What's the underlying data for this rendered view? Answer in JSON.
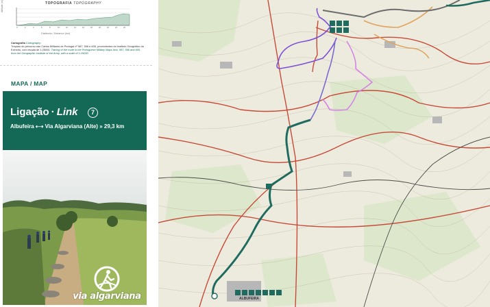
{
  "topography": {
    "title_pt": "TOPOGRAFIA",
    "title_en": "TOPOGRAPHY",
    "x_label": "Distância / Distance (km)",
    "y_label": "Altitude (m)"
  },
  "cartography": {
    "label_pt": "Cartografia",
    "label_en": "Cartography",
    "text_pt": "Traçado do percurso nas Cartas Militares de Portugal nº 587, 596 e 605, provenientes do Instituto Geográfico do Exército, com escala de 1:25000.",
    "text_en": "Tracing of the route in the Portuguese Military Maps Nos. 587, 596 and 605, from the Geographic Institute of the Army, with a scale of 1:25000."
  },
  "map_heading": "MAPA / MAP",
  "link_box": {
    "title_pt": "Ligação",
    "separator": "·",
    "title_en": "Link",
    "number": "7",
    "from": "Albufeira",
    "arrow": "⟷",
    "to_distance": "Via Algarviana (Alte) » 29,3 km"
  },
  "logo": {
    "text": "via algarviana"
  },
  "map": {
    "town_label": "ALBUFEIRA",
    "colors": {
      "link_route": "#206b5f",
      "purple_route": "#7c4fd6",
      "pink_route": "#d484e4",
      "grey_route": "#6b6b6b",
      "orange_route": "#d88a3c",
      "road_red": "#c74a38"
    },
    "icons": [
      "info-icon",
      "restaurant-icon",
      "lodging-icon",
      "hiking-icon",
      "camping-icon",
      "pharmacy-icon",
      "church-icon",
      "atm-icon"
    ]
  }
}
